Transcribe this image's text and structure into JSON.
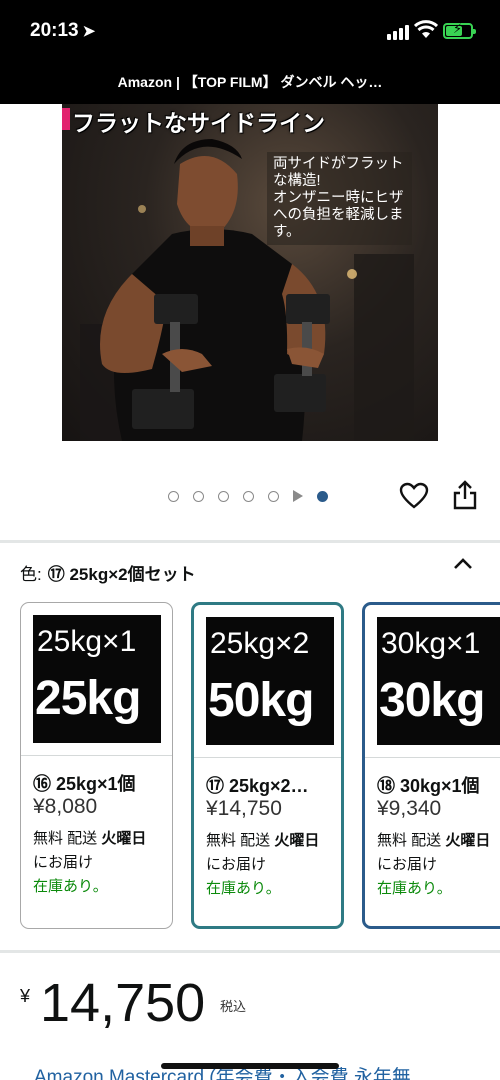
{
  "status": {
    "time": "20:13"
  },
  "page_title": "Amazon | 【TOP FILM】 ダンベル ヘッ…",
  "image": {
    "banner": "フラットなサイドライン",
    "callout": "両サイドがフラットな構造!\nオンザニー時にヒザへの負担を軽減します。"
  },
  "gallery_dots": {
    "count": 7,
    "active_index": 6
  },
  "color": {
    "label": "色:",
    "value": "⑰ 25kg×2個セット"
  },
  "variants": [
    {
      "swatch_small": "25kg×1",
      "swatch_big": "25kg",
      "name": "⑯ 25kg×1個",
      "price": "¥8,080",
      "ship_prefix": "無料 配送 ",
      "ship_day": "火曜日",
      "ship_suffix": "にお届け",
      "stock": "在庫あり。",
      "selected": false
    },
    {
      "swatch_small": "25kg×2",
      "swatch_big": "50kg",
      "name": "⑰ 25kg×2…",
      "price": "¥14,750",
      "ship_prefix": "無料 配送 ",
      "ship_day": "火曜日",
      "ship_suffix": "にお届け",
      "stock": "在庫あり。",
      "selected": true
    },
    {
      "swatch_small": "30kg×1",
      "swatch_big": "30kg",
      "name": "⑱ 30kg×1個",
      "price": "¥9,340",
      "ship_prefix": "無料 配送 ",
      "ship_day": "火曜日",
      "ship_suffix": "にお届け",
      "stock": "在庫あり。",
      "selected": false
    }
  ],
  "price": {
    "currency": "¥",
    "amount": "14,750",
    "tax_note": "税込"
  },
  "promo_text": "Amazon Mastercard (年会費・入会費 永年無",
  "colors": {
    "selected_border": "#2f7a84",
    "stock_green": "#0b8a0b",
    "link_blue": "#2162a1",
    "accent_pink": "#e2236e",
    "battery_green": "#39d353"
  }
}
